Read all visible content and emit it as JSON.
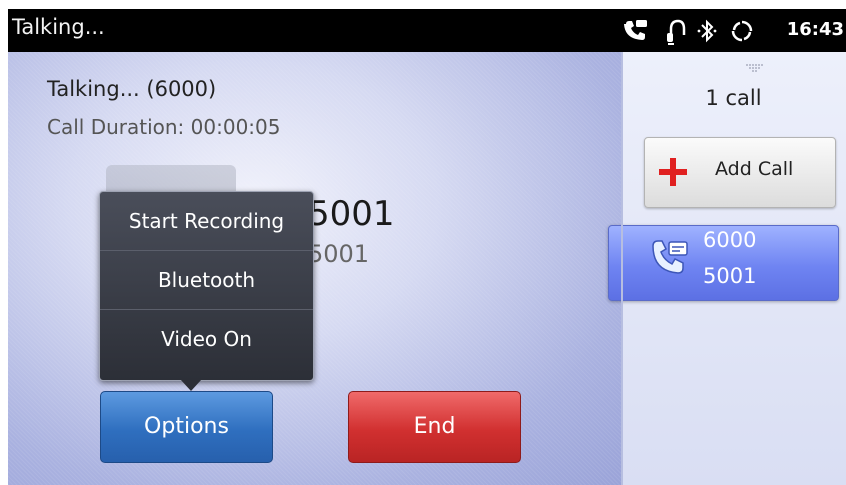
{
  "statusbar": {
    "title": "Talking...",
    "time": "16:43",
    "icons": [
      "voicemail-phone-icon",
      "headset-icon",
      "bluetooth-icon",
      "sync-icon"
    ]
  },
  "call": {
    "status": "Talking... (6000)",
    "duration": "Call Duration: 00:00:05",
    "remote_number_large": "5001",
    "remote_number_small": "5001"
  },
  "options_menu": {
    "items": [
      {
        "label": "Start Recording"
      },
      {
        "label": "Bluetooth"
      },
      {
        "label": "Video On"
      }
    ]
  },
  "buttons": {
    "options": "Options",
    "end": "End"
  },
  "side_panel": {
    "call_count": "1 call",
    "add_call": "Add Call",
    "active_call": {
      "line": "6000",
      "remote": "5001"
    }
  },
  "colors": {
    "options_button": "#2f6fbf",
    "end_button": "#d13030",
    "active_call_card": "#6f84f2",
    "add_call_plus": "#e02020"
  }
}
